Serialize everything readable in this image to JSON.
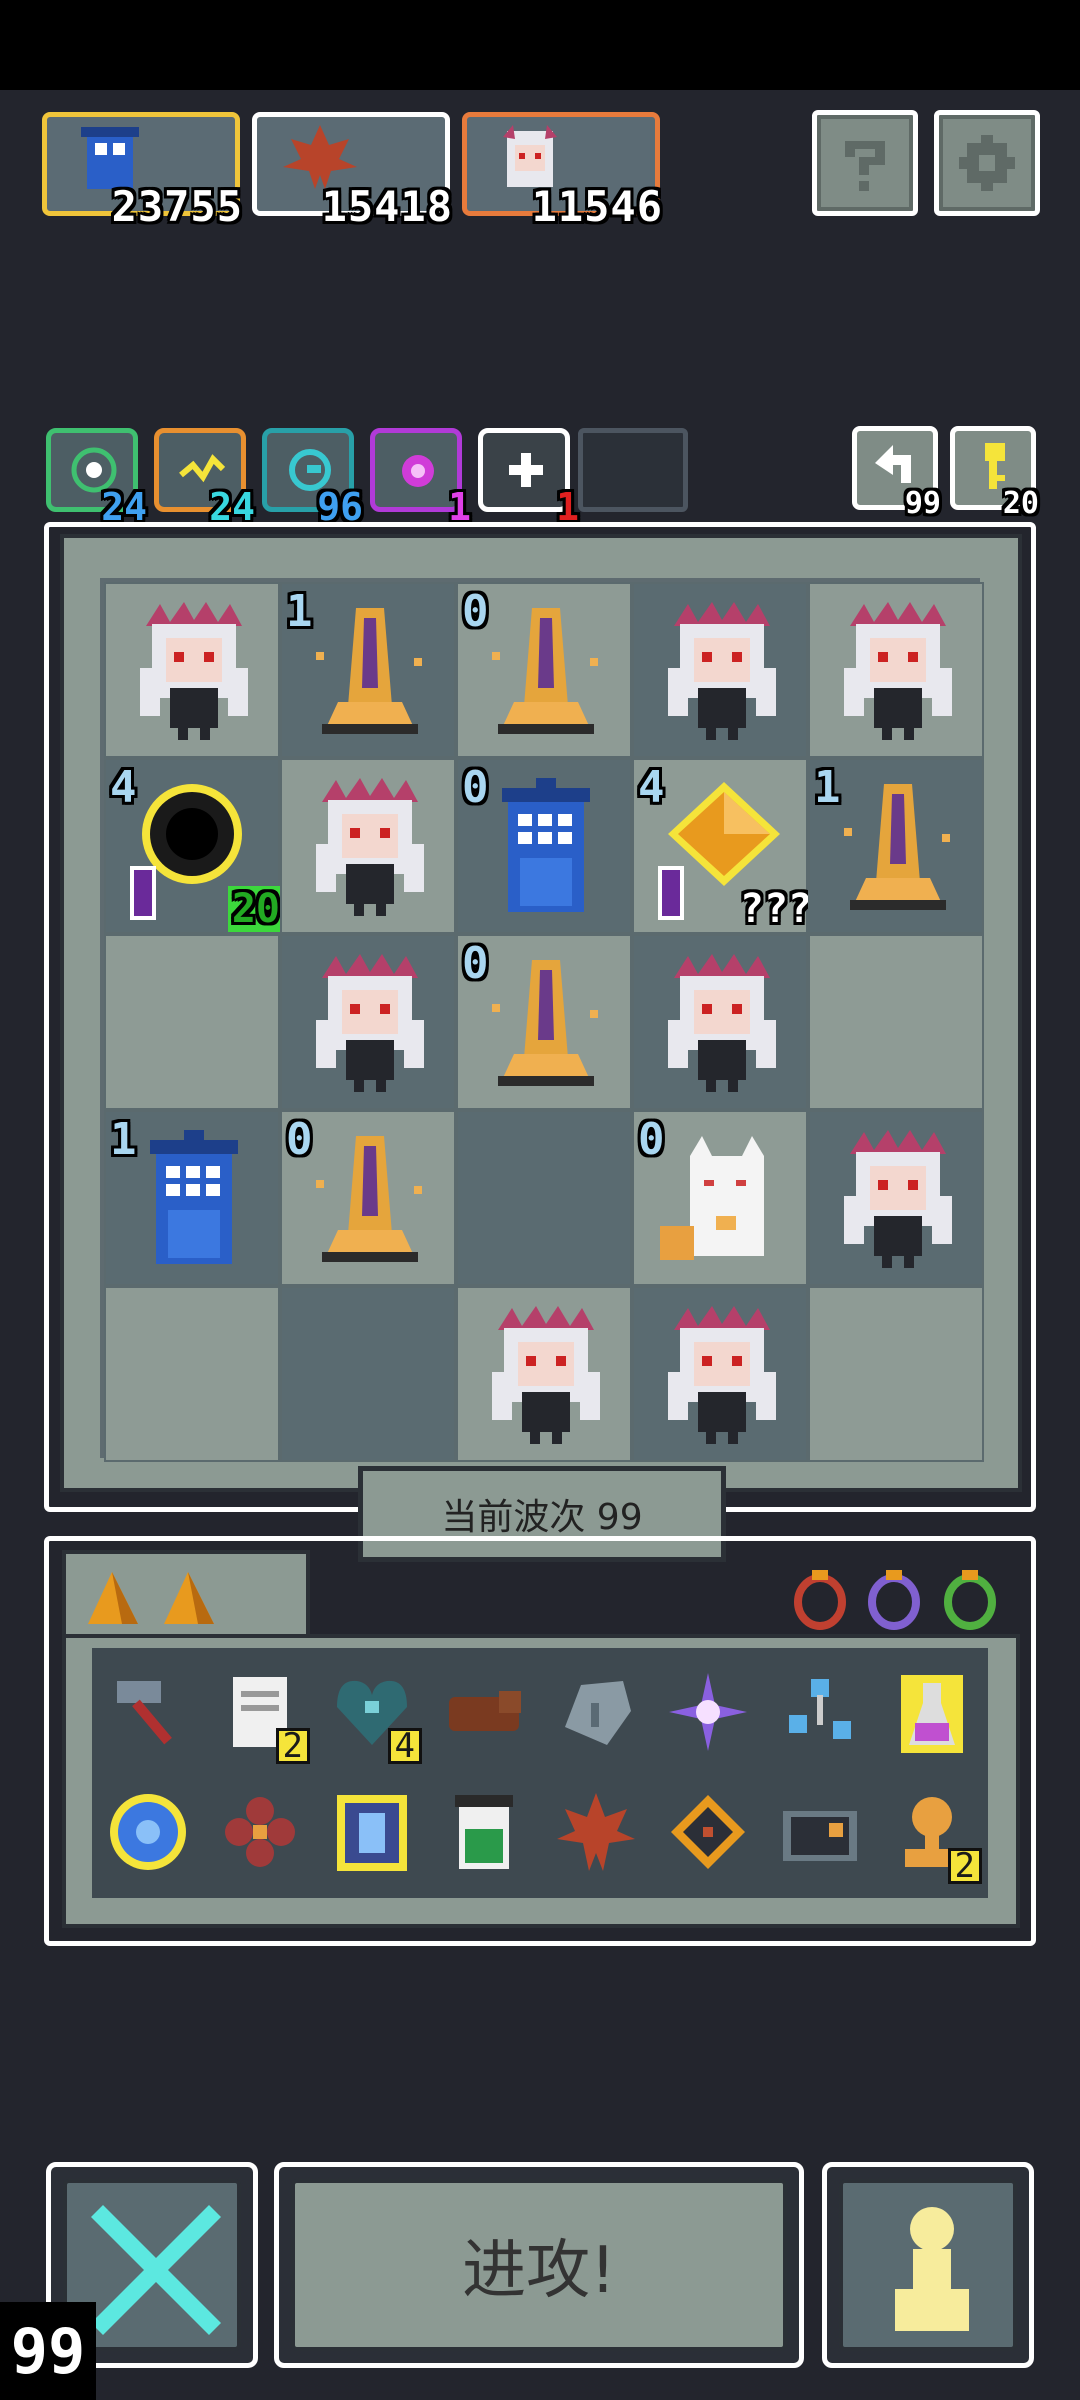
{
  "resources": [
    {
      "icon": "blue-phone-booth-icon",
      "value": "23755",
      "border": "#f0c53a"
    },
    {
      "icon": "maple-leaf-icon",
      "value": "15418",
      "border": "#ffffff"
    },
    {
      "icon": "girl-portrait-icon",
      "value": "11546",
      "border": "#e87b3c"
    }
  ],
  "top_buttons": {
    "help": "question-icon",
    "settings": "gear-icon"
  },
  "buffs": [
    {
      "icon": "green-target-icon",
      "count": "24",
      "color": "#3fc070"
    },
    {
      "icon": "lightning-icon",
      "count": "24",
      "color": "#e89030"
    },
    {
      "icon": "cyan-spiral-icon",
      "count": "96",
      "color": "#28a0a8"
    },
    {
      "icon": "magenta-orb-icon",
      "count": "1",
      "color": "#b13ad8"
    },
    {
      "icon": "white-star-icon",
      "count": "1",
      "color": "#ffffff"
    }
  ],
  "side_counters": [
    {
      "icon": "return-arrow-icon",
      "value": "99"
    },
    {
      "icon": "yellow-key-icon",
      "value": "20"
    }
  ],
  "board": [
    [
      {
        "u": "girl",
        "l": ""
      },
      {
        "u": "pillar",
        "l": "1"
      },
      {
        "u": "pillar",
        "l": "0"
      },
      {
        "u": "girl",
        "l": ""
      },
      {
        "u": "girl",
        "l": ""
      }
    ],
    [
      {
        "u": "blackhole",
        "l": "4",
        "tag": "20"
      },
      {
        "u": "girl",
        "l": ""
      },
      {
        "u": "booth",
        "l": "0"
      },
      {
        "u": "crystal",
        "l": "4",
        "tag": "???"
      },
      {
        "u": "pillar",
        "l": "1"
      }
    ],
    [
      {
        "u": "",
        "l": ""
      },
      {
        "u": "girl",
        "l": ""
      },
      {
        "u": "pillar",
        "l": "0"
      },
      {
        "u": "girl",
        "l": ""
      },
      {
        "u": "",
        "l": ""
      }
    ],
    [
      {
        "u": "booth",
        "l": "1"
      },
      {
        "u": "pillar",
        "l": "0"
      },
      {
        "u": "",
        "l": ""
      },
      {
        "u": "cat",
        "l": "0"
      },
      {
        "u": "girl",
        "l": ""
      }
    ],
    [
      {
        "u": "",
        "l": ""
      },
      {
        "u": "",
        "l": ""
      },
      {
        "u": "girl",
        "l": ""
      },
      {
        "u": "girl",
        "l": ""
      },
      {
        "u": "",
        "l": ""
      }
    ]
  ],
  "wave_label": "当前波次 99",
  "inventory": {
    "shards": [
      "amber-shard-icon",
      "amber-shard-icon"
    ],
    "gems": [
      "red-ring-gem-icon",
      "purple-ring-gem-icon",
      "green-ring-gem-icon"
    ],
    "row1": [
      {
        "icon": "hammer-icon",
        "q": ""
      },
      {
        "icon": "scroll-icon",
        "q": "2"
      },
      {
        "icon": "teal-heart-icon",
        "q": "4"
      },
      {
        "icon": "wood-log-icon",
        "q": ""
      },
      {
        "icon": "grey-stone-icon",
        "q": ""
      },
      {
        "icon": "purple-spark-icon",
        "q": ""
      },
      {
        "icon": "molecule-icon",
        "q": ""
      },
      {
        "icon": "potion-icon",
        "q": ""
      }
    ],
    "row2": [
      {
        "icon": "blue-orb-icon",
        "q": ""
      },
      {
        "icon": "red-flower-icon",
        "q": ""
      },
      {
        "icon": "blue-tower-card-icon",
        "q": ""
      },
      {
        "icon": "recycle-bin-icon",
        "q": ""
      },
      {
        "icon": "maple-leaf-icon",
        "q": ""
      },
      {
        "icon": "diamond-rune-icon",
        "q": ""
      },
      {
        "icon": "camera-icon",
        "q": ""
      },
      {
        "icon": "trophy-icon",
        "q": "2"
      }
    ]
  },
  "bottom": {
    "left_icon": "cross-swords-icon",
    "attack_label": "进攻!",
    "right_icon": "pawn-icon"
  },
  "fps": "99",
  "colors": {
    "background": "#23252d",
    "panel": "#8c9a93",
    "cell_dark": "#5a6b71"
  }
}
